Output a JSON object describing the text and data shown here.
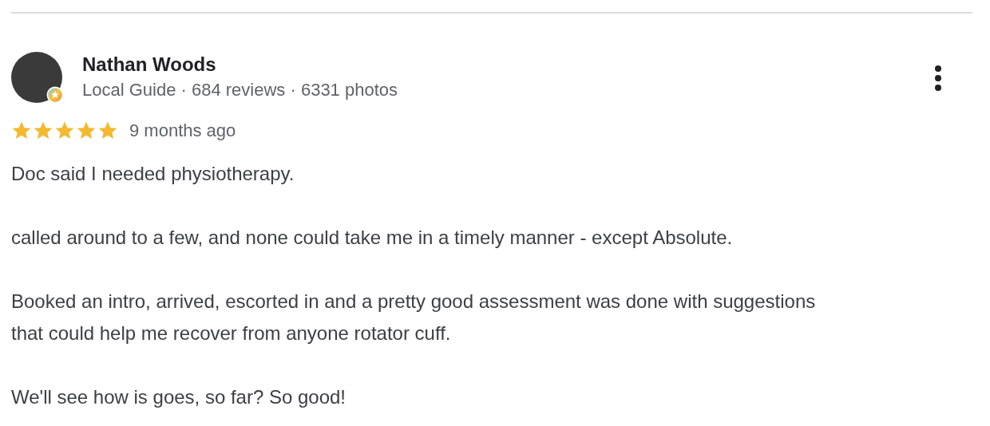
{
  "review": {
    "author": "Nathan Woods",
    "meta": "Local Guide · 684 reviews · 6331 photos",
    "stars": 5,
    "time": "9 months ago",
    "paragraphs": [
      "Doc said I needed physiotherapy.",
      "called around to a few, and none could take me in a timely manner - except Absolute.",
      "Booked an intro, arrived, escorted in and a pretty good assessment was done with suggestions that could help me recover from anyone rotator cuff.",
      "We'll see how is goes, so far? So good!"
    ]
  }
}
